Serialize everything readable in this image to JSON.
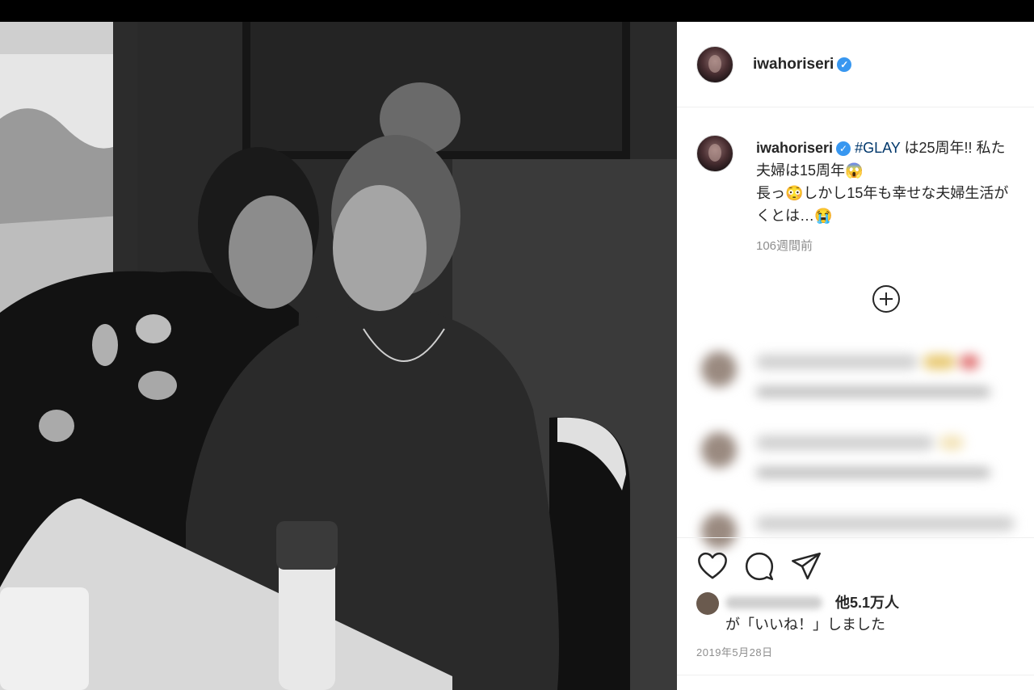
{
  "post": {
    "username": "iwahoriseri",
    "verified_icon": "verified-badge-icon",
    "caption": {
      "hashtag": "#GLAY",
      "line1_rest": " は25周年!! 私た",
      "line2": "夫婦は15周年😱",
      "line3": "長っ😳しかし15年も幸せな夫婦生活が",
      "line4": "くとは…😭"
    },
    "time_ago": "106週間前",
    "load_more_icon": "plus-circle-icon",
    "likes": {
      "others": "他5.1万人",
      "suffix": "が「いいね！」しました"
    },
    "date": "2019年5月28日"
  },
  "actions": [
    {
      "name": "like",
      "icon": "heart-icon"
    },
    {
      "name": "comment",
      "icon": "comment-icon"
    },
    {
      "name": "share",
      "icon": "send-icon"
    }
  ],
  "colors": {
    "verified": "#3897f0",
    "hashtag": "#00376b",
    "text": "#262626",
    "muted": "#8e8e8e"
  }
}
